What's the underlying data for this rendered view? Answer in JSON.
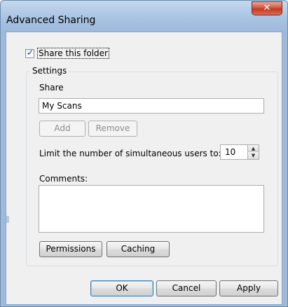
{
  "window": {
    "title": "Advanced Sharing",
    "close_glyph": "✕"
  },
  "share_folder": {
    "label": "Share this folder",
    "checked": true
  },
  "settings": {
    "legend": "Settings",
    "share_label": "Share",
    "share_value": "My Scans",
    "add_label": "Add",
    "remove_label": "Remove",
    "limit_label": "Limit the number of simultaneous users to:",
    "limit_value": "10",
    "comments_label": "Comments:",
    "comments_value": "",
    "permissions_label": "Permissions",
    "caching_label": "Caching"
  },
  "footer": {
    "ok_label": "OK",
    "cancel_label": "Cancel",
    "apply_label": "Apply"
  },
  "icons": {
    "close": "close-icon",
    "check": "checkmark-icon",
    "spin_up": "up-arrow-icon",
    "spin_down": "down-arrow-icon"
  }
}
